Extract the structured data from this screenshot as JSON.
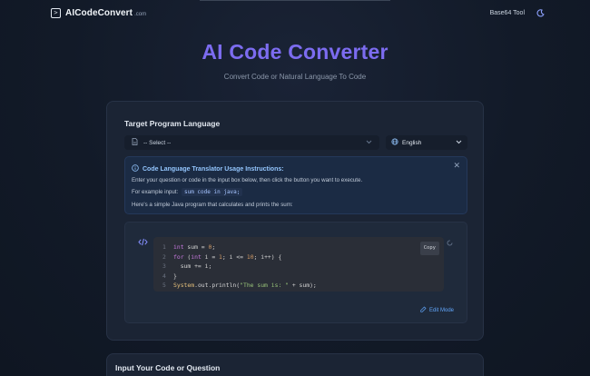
{
  "nav": {
    "brand": "AICodeConvert",
    "brand_tld": ".com",
    "links": [
      "Base64 Tool"
    ],
    "theme_icon": "moon-icon"
  },
  "hero": {
    "title": "AI Code Converter",
    "subtitle": "Convert Code or Natural Language To Code"
  },
  "target": {
    "label": "Target Program Language",
    "select_value": "-- Select --",
    "language_value": "English"
  },
  "instructions": {
    "title": "Code Language Translator Usage Instructions:",
    "line1": "Enter your question or code in the input box below, then click the button you want to execute.",
    "line2_prefix": "For example input:",
    "example_input": "sum code in java;",
    "line3": "Here's a simple Java program that calculates and prints the sum:"
  },
  "example": {
    "copy_label": "Copy",
    "edit_label": "Edit Mode",
    "code_lines": [
      "int sum = 0;",
      "for (int i = 1; i <= 10; i++) {",
      "  sum += i;",
      "}",
      "System.out.println(\"The sum is: \" + sum);"
    ]
  },
  "input_section": {
    "label": "Input Your Code or Question"
  },
  "colors": {
    "accent": "#7c6cf0",
    "link": "#60a5fa",
    "info_title": "#93c5fd"
  }
}
